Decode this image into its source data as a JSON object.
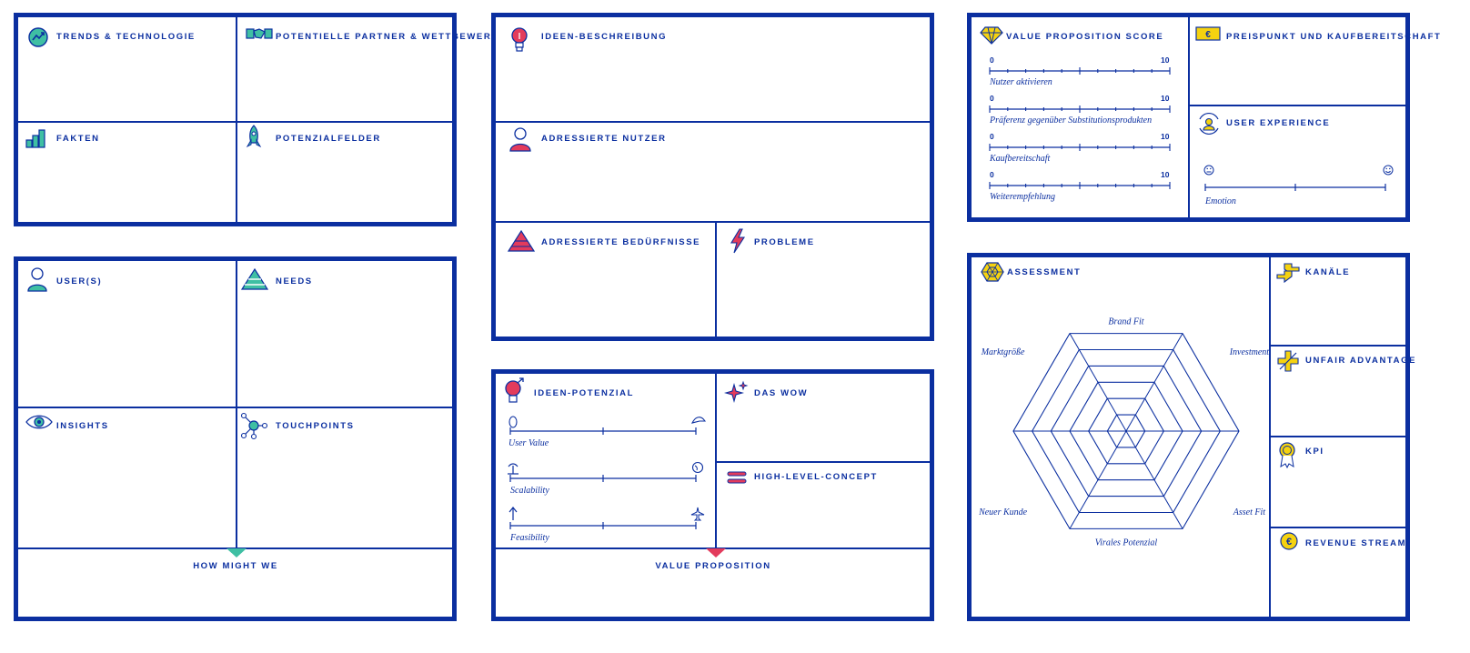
{
  "panels": {
    "research": {
      "trends_label": "TRENDS & TECHNOLOGIE",
      "partner_label": "POTENTIELLE PARTNER & WETTBEWERB",
      "facts_label": "FAKTEN",
      "fields_label": "POTENZIALFELDER"
    },
    "users": {
      "users_label": "USER(S)",
      "needs_label": "NEEDS",
      "insights_label": "INSIGHTS",
      "touchpoints_label": "TOUCHPOINTS",
      "hmw_label": "HOW MIGHT WE"
    },
    "idea": {
      "description_label": "IDEEN-BESCHREIBUNG",
      "addressed_users_label": "ADRESSIERTE NUTZER",
      "needs_label": "ADRESSIERTE BEDÜRFNISSE",
      "problems_label": "PROBLEME"
    },
    "potential": {
      "title": "IDEEN-POTENZIAL",
      "wow_label": "DAS WOW",
      "concept_label": "HIGH-LEVEL-CONCEPT",
      "vp_label": "VALUE PROPOSITION",
      "scales": [
        {
          "label": "User Value"
        },
        {
          "label": "Scalability"
        },
        {
          "label": "Feasibility"
        }
      ]
    },
    "value": {
      "title": "VALUE PROPOSITION SCORE",
      "scale_min": "0",
      "scale_max": "10",
      "scales": [
        {
          "label": "Nutzer aktivieren"
        },
        {
          "label": "Präferenz gegenüber Substitutionsprodukten"
        },
        {
          "label": "Kaufbereitschaft"
        },
        {
          "label": "Weiterempfehlung"
        }
      ],
      "price_label": "PREISPUNKT UND KAUFBEREITSCHAFT",
      "ux_label": "USER EXPERIENCE",
      "emotion_label": "Emotion"
    },
    "assessment": {
      "title": "ASSESSMENT",
      "axes": [
        "Brand Fit",
        "Investment",
        "Asset Fit",
        "Virales Potenzial",
        "Neuer Kunde",
        "Marktgröße"
      ],
      "channels_label": "KANÄLE",
      "unfair_label": "UNFAIR ADVANTAGE",
      "kpi_label": "KPI",
      "revenue_label": "REVENUE STREAM"
    }
  },
  "colors": {
    "frame": "#0b2fa0",
    "teal": "#3fbfa3",
    "red": "#e33b5c",
    "yellow": "#f5d20f"
  }
}
